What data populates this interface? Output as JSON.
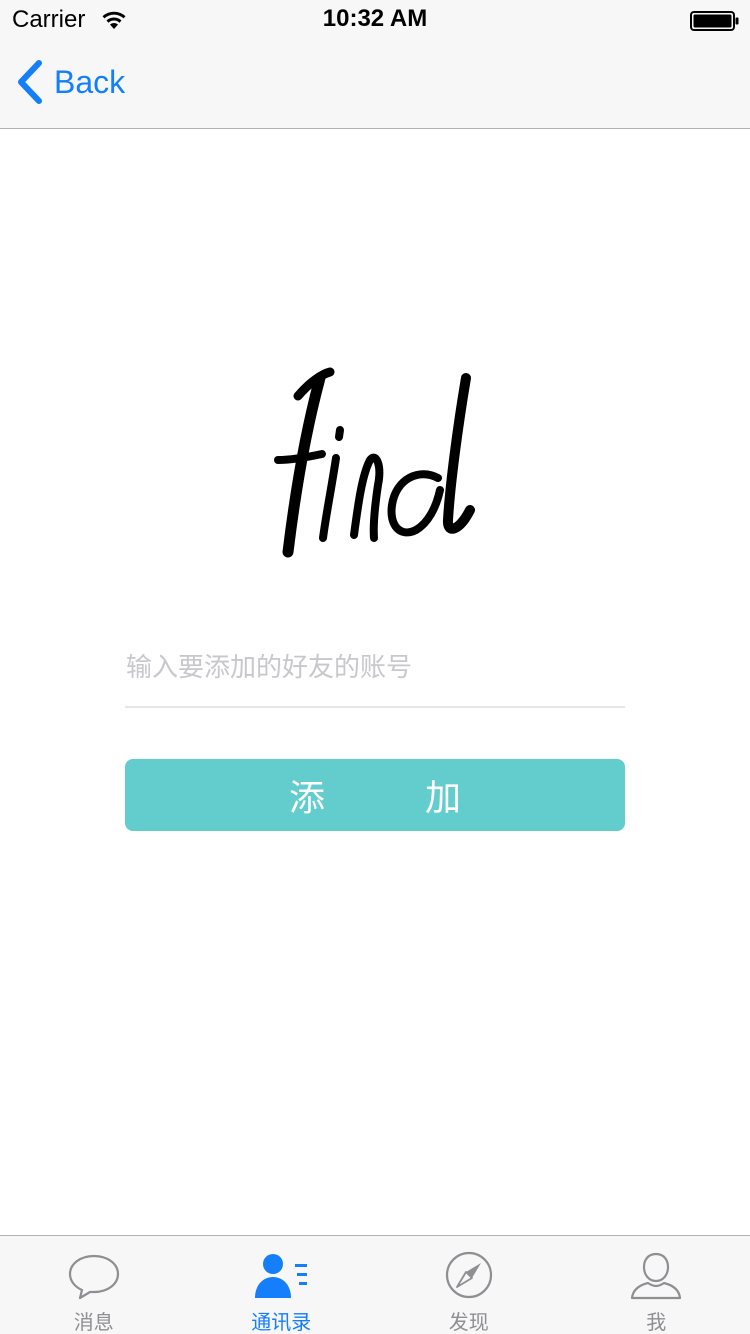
{
  "status_bar": {
    "carrier": "Carrier",
    "time": "10:32 AM"
  },
  "nav": {
    "back_label": "Back"
  },
  "logo": {
    "text": "Find"
  },
  "form": {
    "placeholder": "输入要添加的好友的账号",
    "button_char_1": "添",
    "button_char_2": "加"
  },
  "tabs": [
    {
      "label": "消息",
      "icon": "chat-bubble-icon",
      "active": false
    },
    {
      "label": "通讯录",
      "icon": "contacts-icon",
      "active": true
    },
    {
      "label": "发现",
      "icon": "compass-icon",
      "active": false
    },
    {
      "label": "我",
      "icon": "person-icon",
      "active": false
    }
  ],
  "colors": {
    "accent": "#147efb",
    "button": "#62cdcc",
    "inactive": "#8e8e93"
  }
}
